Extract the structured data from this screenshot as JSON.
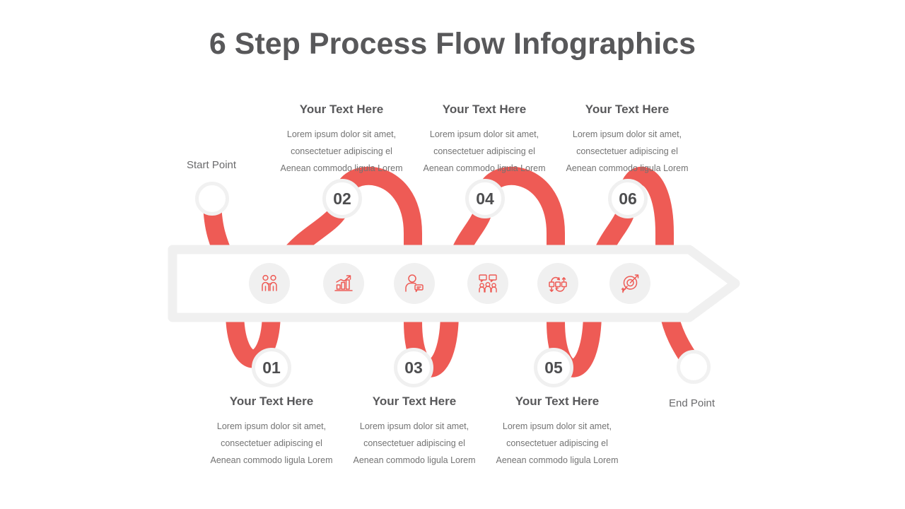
{
  "title": "6 Step Process Flow Infographics",
  "colors": {
    "ribbon_red": "#ee5b55",
    "bar_outline": "#f0f0f0",
    "icon_bg": "#f0f0f0",
    "badge_ring": "#f0f0f0",
    "title_gray": "#58585a",
    "body_gray": "#737373"
  },
  "endpoints": {
    "start": {
      "label": "Start Point"
    },
    "end": {
      "label": "End Point"
    }
  },
  "body_lines": [
    "Lorem ipsum dolor sit amet,",
    "consectetuer adipiscing el",
    "Aenean commodo ligula Lorem"
  ],
  "steps": [
    {
      "number": "01",
      "position": "bottom",
      "icon": "team-icon",
      "heading": "Your Text Here",
      "body": [
        "Lorem ipsum dolor sit amet,",
        "consectetuer adipiscing el",
        "Aenean commodo ligula Lorem"
      ]
    },
    {
      "number": "02",
      "position": "top",
      "icon": "growth-chart-icon",
      "heading": "Your Text Here",
      "body": [
        "Lorem ipsum dolor sit amet,",
        "consectetuer adipiscing el",
        "Aenean commodo ligula Lorem"
      ]
    },
    {
      "number": "03",
      "position": "bottom",
      "icon": "user-feedback-icon",
      "heading": "Your Text Here",
      "body": [
        "Lorem ipsum dolor sit amet,",
        "consectetuer adipiscing el",
        "Aenean commodo ligula Lorem"
      ]
    },
    {
      "number": "04",
      "position": "top",
      "icon": "team-discussion-icon",
      "heading": "Your Text Here",
      "body": [
        "Lorem ipsum dolor sit amet,",
        "consectetuer adipiscing el",
        "Aenean commodo ligula Lorem"
      ]
    },
    {
      "number": "05",
      "position": "bottom",
      "icon": "workflow-cycle-icon",
      "heading": "Your Text Here",
      "body": [
        "Lorem ipsum dolor sit amet,",
        "consectetuer adipiscing el",
        "Aenean commodo ligula Lorem"
      ]
    },
    {
      "number": "06",
      "position": "top",
      "icon": "target-goal-icon",
      "heading": "Your Text Here",
      "body": [
        "Lorem ipsum dolor sit amet,",
        "consectetuer adipiscing el",
        "Aenean commodo ligula Lorem"
      ]
    }
  ]
}
